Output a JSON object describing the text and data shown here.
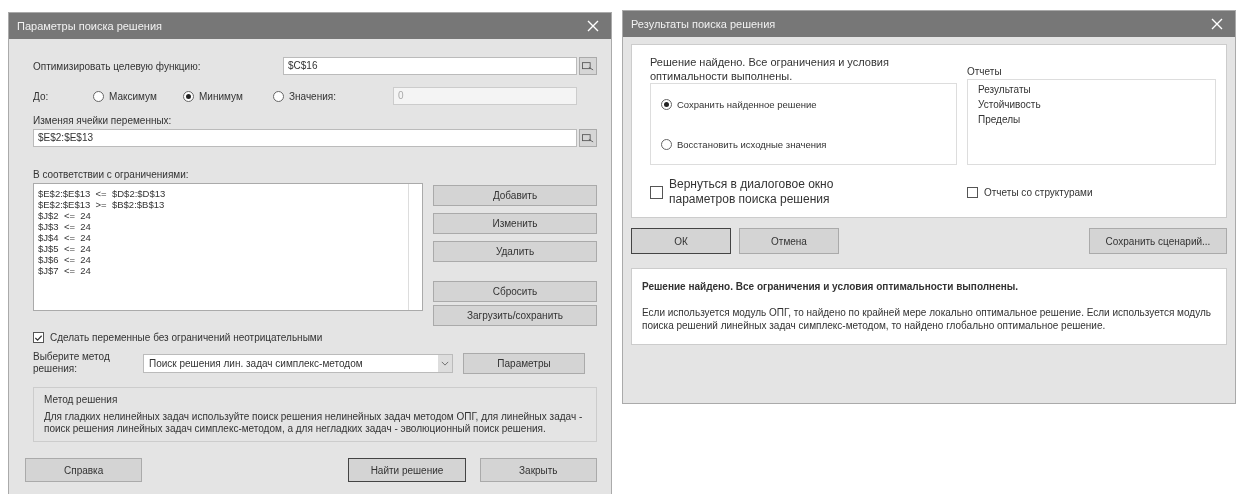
{
  "solver_dialog": {
    "title": "Параметры поиска решения",
    "objective": {
      "label": "Оптимизировать целевую функцию:",
      "value": "$C$16"
    },
    "to_label": "До:",
    "goal_options": [
      {
        "label": "Максимум",
        "selected": false
      },
      {
        "label": "Минимум",
        "selected": true
      },
      {
        "label": "Значения:",
        "selected": false
      }
    ],
    "goal_value": {
      "value": "0",
      "disabled": true
    },
    "variables": {
      "label": "Изменяя ячейки переменных:",
      "value": "$E$2:$E$13"
    },
    "constraints_label": "В соответствии с ограничениями:",
    "constraints": [
      "$E$2:$E$13  <=  $D$2:$D$13",
      "$E$2:$E$13  >=  $B$2:$B$13",
      "$J$2  <=  24",
      "$J$3  <=  24",
      "$J$4  <=  24",
      "$J$5  <=  24",
      "$J$6  <=  24",
      "$J$7  <=  24"
    ],
    "constraint_buttons": [
      "Добавить",
      "Изменить",
      "Удалить",
      "Сбросить",
      "Загрузить/сохранить"
    ],
    "nonnegative": {
      "label": "Сделать переменные без ограничений неотрицательными",
      "checked": true
    },
    "method_label": "Выберите метод решения:",
    "method": "Поиск решения лин. задач симплекс-методом",
    "options_button": "Параметры",
    "method_box": {
      "title": "Метод решения",
      "text": "Для гладких нелинейных задач используйте поиск решения нелинейных задач методом ОПГ, для линейных задач - поиск решения линейных задач симплекс-методом, а для негладких задач - эволюционный поиск решения."
    },
    "footer_buttons": [
      {
        "label": "Справка",
        "default": false
      },
      {
        "label": "Найти решение",
        "default": true
      },
      {
        "label": "Закрыть",
        "default": false
      }
    ]
  },
  "results_dialog": {
    "title": "Результаты поиска решения",
    "message": "Решение найдено. Все ограничения и условия оптимальности выполнены.",
    "keep_options": [
      {
        "label": "Сохранить найденное решение",
        "selected": true
      },
      {
        "label": "Восстановить исходные значения",
        "selected": false
      }
    ],
    "reports_label": "Отчеты",
    "reports": [
      "Результаты",
      "Устойчивость",
      "Пределы"
    ],
    "return_checkbox": {
      "label": "Вернуться в диалоговое окно параметров поиска решения",
      "checked": false
    },
    "outline_checkbox": {
      "label": "Отчеты со структурами",
      "checked": false
    },
    "buttons": [
      {
        "label": "ОК",
        "default": true
      },
      {
        "label": "Отмена",
        "default": false
      }
    ],
    "save_scenario": "Сохранить сценарий...",
    "info_title": "Решение найдено. Все ограничения и условия оптимальности выполнены.",
    "info_text": "Если используется модуль ОПГ, то найдено по крайней мере локально оптимальное решение. Если используется модуль поиска решений линейных задач симплекс-методом, то найдено глобально оптимальное решение."
  }
}
